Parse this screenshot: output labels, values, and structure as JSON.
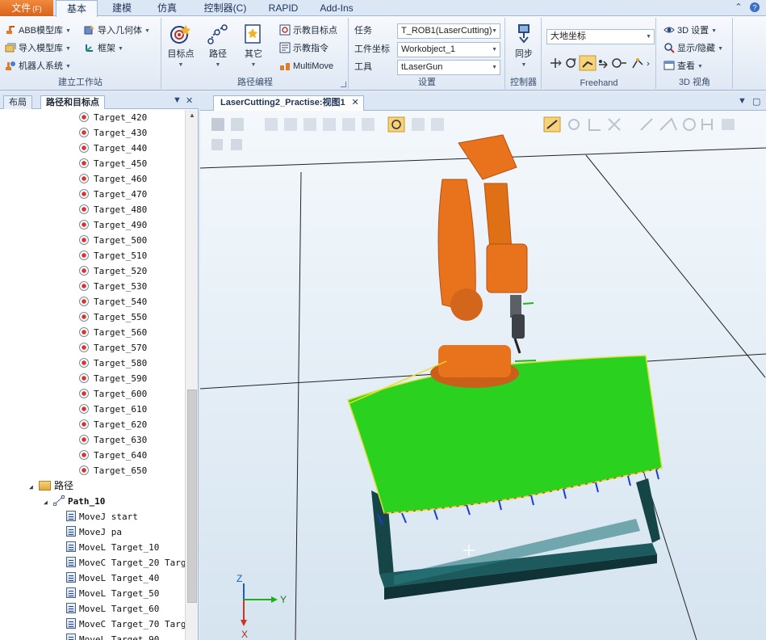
{
  "menubar": {
    "file": "文件",
    "file_hotkey": "(F)",
    "tabs": [
      "基本",
      "建模",
      "仿真",
      "控制器(C)",
      "RAPID",
      "Add-Ins"
    ],
    "active_tab": "基本"
  },
  "ribbon": {
    "build_station": {
      "label": "建立工作站",
      "abb_library": "ABB模型库",
      "import_geometry": "导入几何体",
      "import_model_library": "导入模型库",
      "frame": "框架",
      "robot_system": "机器人系统"
    },
    "path_programming": {
      "label": "路径编程",
      "target": "目标点",
      "path": "路径",
      "other": "其它",
      "teach_target": "示教目标点",
      "teach_instruction": "示教指令",
      "multimove": "MultiMove"
    },
    "settings": {
      "label": "设置",
      "task_label": "任务",
      "task_value": "T_ROB1(LaserCutting)",
      "wobj_label": "工件坐标",
      "wobj_value": "Workobject_1",
      "tool_label": "工具",
      "tool_value": "tLaserGun"
    },
    "controller": {
      "label": "控制器",
      "sync": "同步"
    },
    "freehand": {
      "label": "Freehand",
      "coordinate_system": "大地坐标"
    },
    "view3d": {
      "label": "3D 视角",
      "settings_3d": "3D 设置",
      "show_hide": "显示/隐藏",
      "view": "查看"
    }
  },
  "left_panel": {
    "tabs": [
      "布局",
      "路径和目标点"
    ],
    "active_tab": "路径和目标点",
    "targets": [
      "Target_420",
      "Target_430",
      "Target_440",
      "Target_450",
      "Target_460",
      "Target_470",
      "Target_480",
      "Target_490",
      "Target_500",
      "Target_510",
      "Target_520",
      "Target_530",
      "Target_540",
      "Target_550",
      "Target_560",
      "Target_570",
      "Target_580",
      "Target_590",
      "Target_600",
      "Target_610",
      "Target_620",
      "Target_630",
      "Target_640",
      "Target_650"
    ],
    "paths_folder": "路径",
    "path_name": "Path_10",
    "instructions": [
      "MoveJ start",
      "MoveJ pa",
      "MoveL Target_10",
      "MoveC Target_20 Target_",
      "MoveL Target_40",
      "MoveL Target_50",
      "MoveL Target_60",
      "MoveC Target_70 Target_",
      "MoveL Target_90"
    ]
  },
  "viewport": {
    "tab_title": "LaserCutting2_Practise:视图1",
    "axis_x": "X",
    "axis_y": "Y",
    "axis_z": "Z",
    "robot_color": "#e8731c",
    "surface_color": "#28c81e",
    "table_color": "#1d5a5e"
  }
}
